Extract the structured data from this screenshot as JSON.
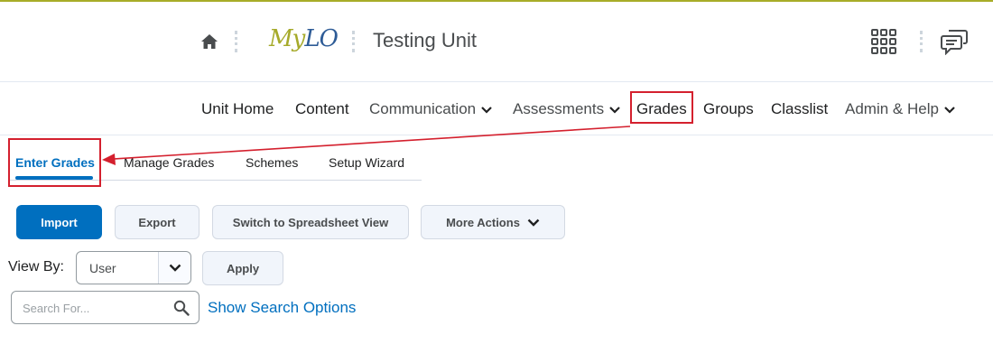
{
  "header": {
    "logo_my": "My",
    "logo_lo": "LO",
    "unit_title": "Testing Unit",
    "icons": [
      "home-icon",
      "waffle-icon",
      "chat-icon"
    ]
  },
  "nav": {
    "items": [
      {
        "label": "Unit Home"
      },
      {
        "label": "Content"
      },
      {
        "label": "Communication"
      },
      {
        "label": "Assessments"
      },
      {
        "label": "Grades"
      },
      {
        "label": "Groups"
      },
      {
        "label": "Classlist"
      },
      {
        "label": "Admin & Help"
      }
    ]
  },
  "subtabs": {
    "items": [
      {
        "label": "Enter Grades",
        "active": true
      },
      {
        "label": "Manage Grades"
      },
      {
        "label": "Schemes"
      },
      {
        "label": "Setup Wizard"
      }
    ]
  },
  "toolbar": {
    "import_label": "Import",
    "export_label": "Export",
    "spreadsheet_label": "Switch to Spreadsheet View",
    "more_actions_label": "More Actions"
  },
  "view_by": {
    "label": "View By:",
    "selected": "User",
    "apply_label": "Apply"
  },
  "search": {
    "placeholder": "Search For...",
    "options_link": "Show Search Options"
  },
  "colors": {
    "accent": "#a8ad28",
    "primary": "#006fbf",
    "annotation": "#d4202e"
  }
}
